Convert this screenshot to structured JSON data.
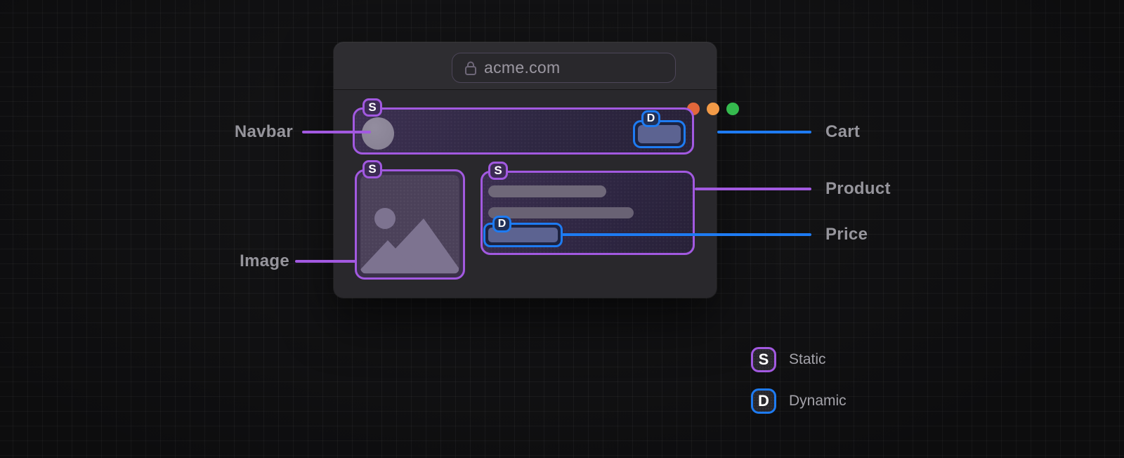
{
  "browser": {
    "url": "acme.com",
    "window_controls": [
      "close",
      "minimize",
      "zoom"
    ],
    "traffic_light_colors": [
      "#e2673a",
      "#f29a47",
      "#35ba4e"
    ]
  },
  "annotations": {
    "navbar": {
      "label": "Navbar",
      "badge": "S",
      "type": "static"
    },
    "cart": {
      "label": "Cart",
      "badge": "D",
      "type": "dynamic"
    },
    "image": {
      "label": "Image",
      "badge": "S",
      "type": "static"
    },
    "product": {
      "label": "Product",
      "badge": "S",
      "type": "static"
    },
    "price": {
      "label": "Price",
      "badge": "D",
      "type": "dynamic"
    }
  },
  "legend": {
    "items": [
      {
        "badge": "S",
        "label": "Static",
        "color": "#a259e0"
      },
      {
        "badge": "D",
        "label": "Dynamic",
        "color": "#1e7bf2"
      }
    ]
  },
  "colors": {
    "static_accent": "#a259e0",
    "dynamic_accent": "#1e7bf2",
    "background": "#121214"
  },
  "icons": {
    "url_lock": "lock-icon",
    "image_placeholder": "image-mountains-icon",
    "navbar_logo": "avatar-circle"
  }
}
